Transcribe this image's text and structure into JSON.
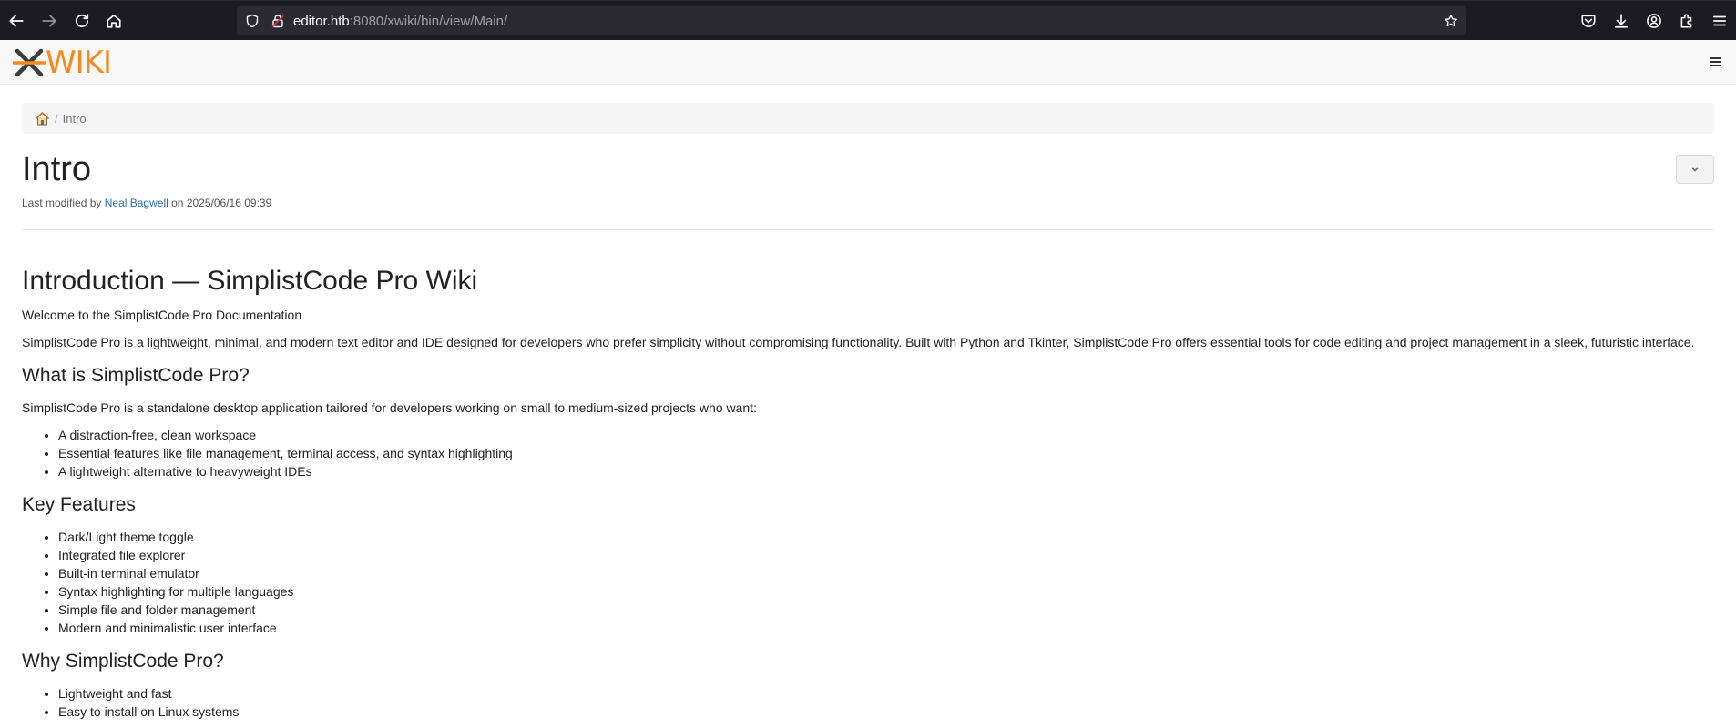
{
  "browser": {
    "url_host": "editor.htb",
    "url_rest": ":8080/xwiki/bin/view/Main/"
  },
  "header": {
    "logo_text": "WIKI"
  },
  "breadcrumb": {
    "current": "Intro",
    "separator": "/"
  },
  "page": {
    "title": "Intro",
    "meta_prefix": "Last modified by",
    "author": "Neal Bagwell",
    "meta_on": "on",
    "modified_date": "2025/06/16 09:39"
  },
  "content": {
    "heading": "Introduction — SimplistCode Pro Wiki",
    "welcome": "Welcome to the SimplistCode Pro Documentation",
    "intro": "SimplistCode Pro is a lightweight, minimal, and modern text editor and IDE designed for developers who prefer simplicity without compromising functionality. Built with Python and Tkinter, SimplistCode Pro offers essential tools for code editing and project management in a sleek, futuristic interface.",
    "section_what": {
      "title": "What is SimplistCode Pro?",
      "text": "SimplistCode Pro is a standalone desktop application tailored for developers working on small to medium-sized projects who want:",
      "items": [
        "A distraction-free, clean workspace",
        "Essential features like file management, terminal access, and syntax highlighting",
        "A lightweight alternative to heavyweight IDEs"
      ]
    },
    "section_features": {
      "title": "Key Features",
      "items": [
        "Dark/Light theme toggle",
        "Integrated file explorer",
        "Built-in terminal emulator",
        "Syntax highlighting for multiple languages",
        "Simple file and folder management",
        "Modern and minimalistic user interface"
      ]
    },
    "section_why": {
      "title": "Why SimplistCode Pro?",
      "items": [
        "Lightweight and fast",
        "Easy to install on Linux systems"
      ]
    }
  },
  "colors": {
    "logo_orange": "#f68a1e",
    "link_blue": "#2a6fb5",
    "browser_bg": "#1c1b22"
  }
}
